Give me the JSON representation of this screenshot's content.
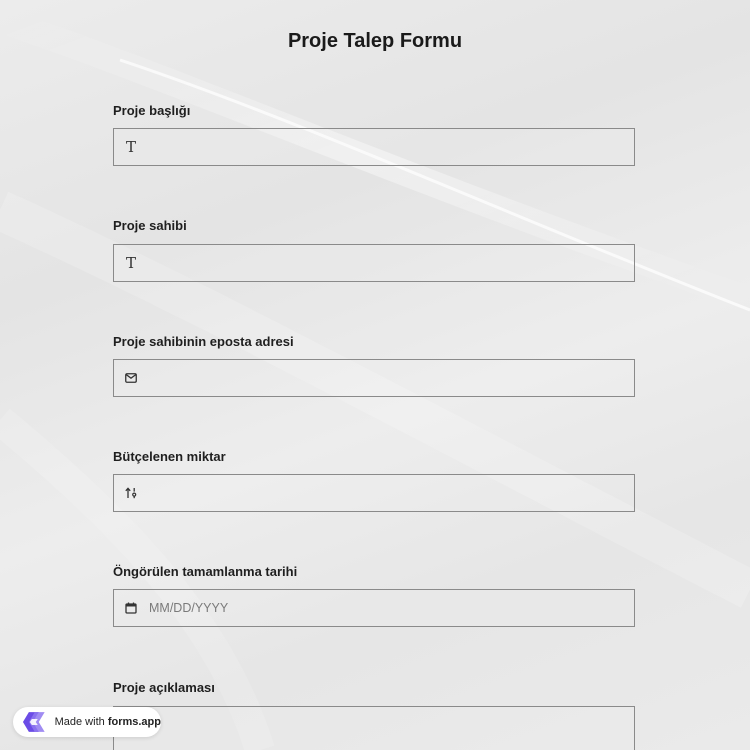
{
  "form": {
    "title": "Proje Talep Formu",
    "fields": [
      {
        "label": "Proje başlığı",
        "icon": "text-icon",
        "placeholder": ""
      },
      {
        "label": "Proje sahibi",
        "icon": "text-icon",
        "placeholder": ""
      },
      {
        "label": "Proje sahibinin eposta adresi",
        "icon": "mail-icon",
        "placeholder": ""
      },
      {
        "label": "Bütçelenen miktar",
        "icon": "number-sort-icon",
        "placeholder": ""
      },
      {
        "label": "Öngörülen tamamlanma tarihi",
        "icon": "calendar-icon",
        "placeholder": "MM/DD/YYYY"
      },
      {
        "label": "Proje açıklaması",
        "icon": "",
        "placeholder": ""
      }
    ]
  },
  "badge": {
    "prefix": "Made with",
    "brand": "forms.app"
  },
  "colors": {
    "background": "#e9e9e9",
    "border": "#8a8a8a",
    "text": "#1f1f1f",
    "brand_purple": "#6b4ce6"
  }
}
